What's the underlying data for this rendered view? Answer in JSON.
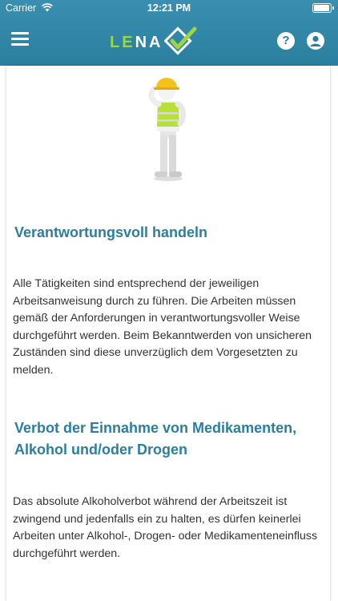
{
  "status_bar": {
    "carrier": "Carrier",
    "time": "12:21 PM",
    "battery_level": 0.95
  },
  "header": {
    "logo": {
      "left": "LE",
      "right": "NA"
    },
    "icons": [
      "menu-icon",
      "help-icon",
      "user-icon"
    ],
    "help_glyph": "?"
  },
  "colors": {
    "header": "#2a7f9f",
    "accent": "#9ed63f",
    "heading": "#2a7f9f"
  },
  "sections": [
    {
      "heading": "Verantwortungsvoll handeln",
      "paragraph": "Alle Tätigkeiten sind entsprechend der jeweiligen Arbeitsanweisung durch zu führen. Die Arbeiten müssen gemäß der Anforderungen in verantwortungsvoller Weise durchgeführt werden. Beim Bekanntwerden von unsicheren Zuständen sind diese unverzüglich dem Vorgesetzten zu melden."
    },
    {
      "heading": "Verbot der Einnahme von Medikamenten, Alkohol und/oder Drogen",
      "paragraph": "Das absolute Alkoholverbot während der Arbeitszeit ist zwingend und jedenfalls ein zu halten, es dürfen keinerlei Arbeiten unter Alkohol-, Drogen- oder Medikamenteneinfluss durchgeführt werden."
    }
  ]
}
